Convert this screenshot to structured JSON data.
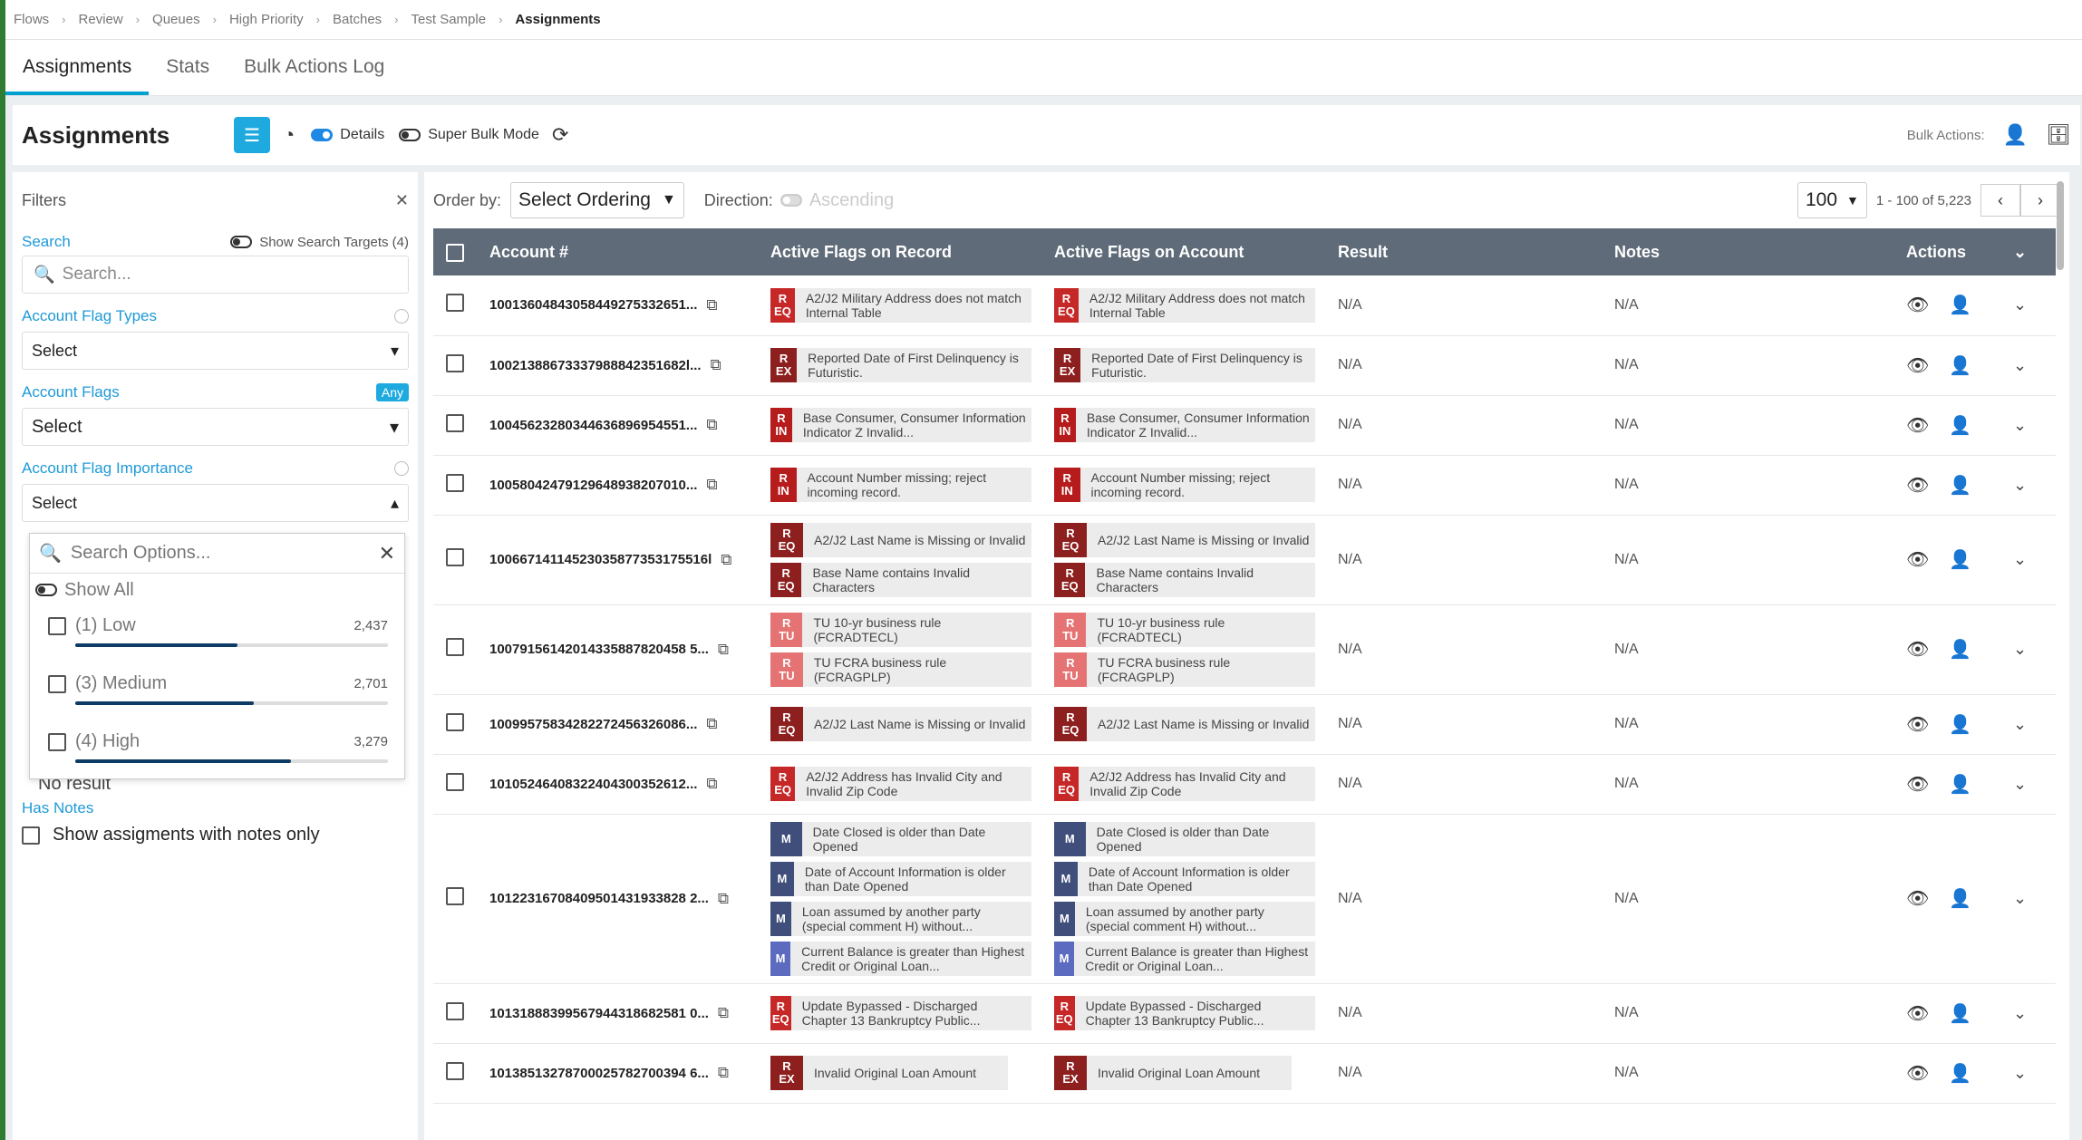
{
  "breadcrumb": [
    "Flows",
    "Review",
    "Queues",
    "High Priority",
    "Batches",
    "Test Sample",
    "Assignments"
  ],
  "tabs": [
    "Assignments",
    "Stats",
    "Bulk Actions Log"
  ],
  "toolbar": {
    "title": "Assignments",
    "details_label": "Details",
    "super_bulk_label": "Super Bulk Mode",
    "bulk_actions_label": "Bulk Actions:"
  },
  "filters": {
    "title": "Filters",
    "search_label": "Search",
    "show_search_targets": "Show Search Targets (4)",
    "search_placeholder": "Search...",
    "flag_types_label": "Account Flag Types",
    "flag_types_value": "Select",
    "flags_label": "Account Flags",
    "flags_any": "Any",
    "flags_value": "Select",
    "importance_label": "Account Flag Importance",
    "importance_value": "Select",
    "dropdown": {
      "search_placeholder": "Search Options...",
      "show_all": "Show All",
      "options": [
        {
          "label": "(1) Low",
          "count": "2,437",
          "fill": 0.52
        },
        {
          "label": "(3) Medium",
          "count": "2,701",
          "fill": 0.57
        },
        {
          "label": "(4) High",
          "count": "3,279",
          "fill": 0.69
        }
      ]
    },
    "hidden_option": "No result",
    "has_notes_label": "Has Notes",
    "notes_only_label": "Show assigments with notes only"
  },
  "ordering": {
    "order_by_label": "Order by:",
    "order_value": "Select Ordering",
    "direction_label": "Direction:",
    "direction_value": "Ascending",
    "page_size": "100",
    "range": "1 - 100 of 5,223"
  },
  "table": {
    "headers": [
      "Account #",
      "Active Flags on Record",
      "Active Flags on Account",
      "Result",
      "Notes",
      "Actions"
    ],
    "rows": [
      {
        "account": "10013604843058449275332651...",
        "result": "N/A",
        "notes": "N/A",
        "flags": [
          {
            "b1": "R",
            "b2": "EQ",
            "cls": "b-eq",
            "text": "A2/J2 Military Address does not match Internal Table"
          }
        ]
      },
      {
        "account": "10021388673337988842351682l...",
        "result": "N/A",
        "notes": "N/A",
        "flags": [
          {
            "b1": "R",
            "b2": "EX",
            "cls": "b-ex",
            "text": "Reported Date of First Delinquency is Futuristic."
          }
        ]
      },
      {
        "account": "10045623280344636896954551...",
        "result": "N/A",
        "notes": "N/A",
        "flags": [
          {
            "b1": "R",
            "b2": "IN",
            "cls": "b-in",
            "text": "Base Consumer, Consumer Information Indicator Z Invalid..."
          }
        ]
      },
      {
        "account": "10058042479129648938207010...",
        "result": "N/A",
        "notes": "N/A",
        "flags": [
          {
            "b1": "R",
            "b2": "IN",
            "cls": "b-in",
            "text": "Account Number missing; reject incoming record."
          }
        ]
      },
      {
        "account": "10066714114523035877353175516l",
        "result": "N/A",
        "notes": "N/A",
        "flags": [
          {
            "b1": "R",
            "b2": "EQ",
            "cls": "b-ex",
            "text": "A2/J2 Last Name is Missing or Invalid"
          },
          {
            "b1": "R",
            "b2": "EQ",
            "cls": "b-ex",
            "text": "Base Name contains Invalid Characters"
          }
        ]
      },
      {
        "account": "10079156142014335887820458 5...",
        "result": "N/A",
        "notes": "N/A",
        "flags": [
          {
            "b1": "R",
            "b2": "TU",
            "cls": "b-tu",
            "text": "TU 10-yr business rule (FCRADTECL)"
          },
          {
            "b1": "R",
            "b2": "TU",
            "cls": "b-tu",
            "text": "TU FCRA business rule (FCRAGPLP)"
          }
        ]
      },
      {
        "account": "10099575834282272456326086...",
        "result": "N/A",
        "notes": "N/A",
        "flags": [
          {
            "b1": "R",
            "b2": "EQ",
            "cls": "b-ex",
            "text": "A2/J2 Last Name is Missing or Invalid"
          }
        ]
      },
      {
        "account": "10105246408322404300352612...",
        "result": "N/A",
        "notes": "N/A",
        "flags": [
          {
            "b1": "R",
            "b2": "EQ",
            "cls": "b-eq",
            "text": "A2/J2 Address has Invalid City and Invalid Zip Code"
          }
        ]
      },
      {
        "account": "10122316708409501431933828 2...",
        "result": "N/A",
        "notes": "N/A",
        "flags": [
          {
            "b1": "M",
            "b2": "",
            "cls": "b-m",
            "text": "Date Closed is older than Date Opened"
          },
          {
            "b1": "M",
            "b2": "",
            "cls": "b-m",
            "text": "Date of Account Information is older than Date Opened"
          },
          {
            "b1": "M",
            "b2": "",
            "cls": "b-m",
            "text": "Loan assumed by another party (special comment H) without..."
          },
          {
            "b1": "M",
            "b2": "",
            "cls": "b-m2",
            "text": "Current Balance is greater than Highest Credit or Original Loan..."
          }
        ]
      },
      {
        "account": "10131888399567944318682581 0...",
        "result": "N/A",
        "notes": "N/A",
        "flags": [
          {
            "b1": "R",
            "b2": "EQ",
            "cls": "b-eq",
            "text": "Update Bypassed - Discharged Chapter 13 Bankruptcy Public..."
          }
        ]
      },
      {
        "account": "10138513278700025782700394 6...",
        "result": "N/A",
        "notes": "N/A",
        "flags": [
          {
            "b1": "R",
            "b2": "EX",
            "cls": "b-ex",
            "text": "Invalid Original Loan Amount",
            "short": true
          }
        ]
      }
    ]
  }
}
